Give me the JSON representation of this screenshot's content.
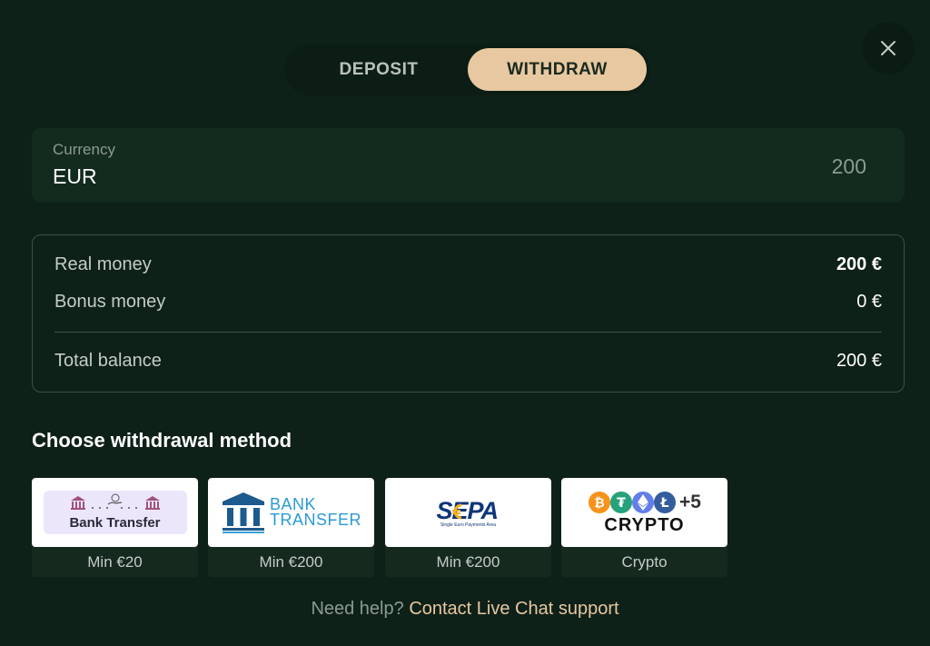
{
  "tabs": {
    "deposit": "DEPOSIT",
    "withdraw": "WITHDRAW",
    "active": "withdraw"
  },
  "currency": {
    "label": "Currency",
    "value": "EUR",
    "amount": "200"
  },
  "balance": {
    "real_label": "Real money",
    "real_value": "200 €",
    "bonus_label": "Bonus money",
    "bonus_value": "0 €",
    "total_label": "Total balance",
    "total_value": "200 €"
  },
  "methods_title": "Choose withdrawal method",
  "methods": [
    {
      "logo_text": "Bank Transfer",
      "caption": "Min €20",
      "icon": "bank-transfer-logo"
    },
    {
      "logo_text_1": "BANK",
      "logo_text_2": "TRANSFER",
      "caption": "Min €200",
      "icon": "bank-building-logo"
    },
    {
      "logo_text": "SEPA",
      "logo_subtext": "Single Euro Payments Area",
      "caption": "Min €200",
      "icon": "sepa-logo"
    },
    {
      "logo_text": "CRYPTO",
      "logo_extra": "+5",
      "caption": "Crypto",
      "icon": "crypto-coins-logo"
    }
  ],
  "help": {
    "text": "Need help?",
    "link": "Contact Live Chat support"
  },
  "colors": {
    "background": "#0e2118",
    "accent": "#e8c8a0",
    "panel": "#132b1e",
    "link": "#e8c8a0"
  }
}
